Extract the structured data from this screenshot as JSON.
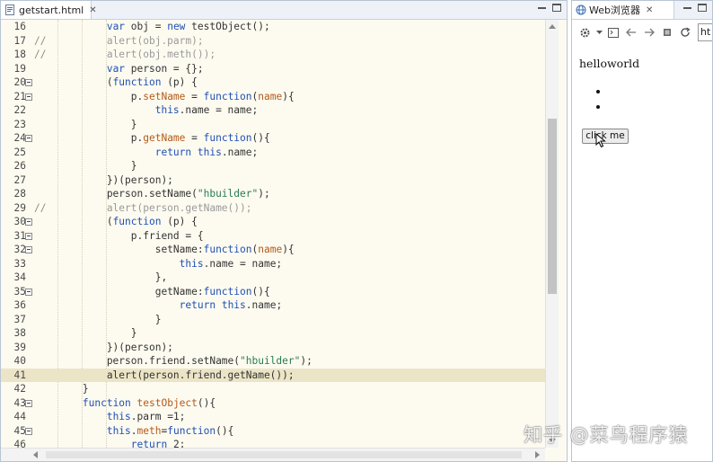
{
  "editor": {
    "tab_label": "getstart.html",
    "tab_close": "✕",
    "lines": [
      {
        "n": "16",
        "fold": false,
        "hl": false,
        "comment": "",
        "html": "            <span>var</span> obj = <span>new</span> testObject();",
        "segs": [
          [
            "            ",
            ""
          ],
          [
            "var",
            "k"
          ],
          [
            " obj = ",
            ""
          ],
          [
            "new",
            "k"
          ],
          [
            " testObject();",
            ""
          ]
        ]
      },
      {
        "n": "17",
        "fold": false,
        "hl": false,
        "comment": "//",
        "segs": [
          [
            "            alert(obj.parm);",
            "c"
          ]
        ]
      },
      {
        "n": "18",
        "fold": false,
        "hl": false,
        "comment": "//",
        "segs": [
          [
            "            alert(obj.meth());",
            "c"
          ]
        ]
      },
      {
        "n": "19",
        "fold": false,
        "hl": false,
        "comment": "",
        "segs": [
          [
            "            ",
            ""
          ],
          [
            "var",
            "k"
          ],
          [
            " person = {};",
            ""
          ]
        ]
      },
      {
        "n": "20",
        "fold": true,
        "hl": false,
        "comment": "",
        "segs": [
          [
            "            (",
            ""
          ],
          [
            "function",
            "k"
          ],
          [
            " (p) {",
            ""
          ]
        ]
      },
      {
        "n": "21",
        "fold": true,
        "hl": false,
        "comment": "",
        "segs": [
          [
            "                p.",
            ""
          ],
          [
            "setName",
            "f"
          ],
          [
            " = ",
            ""
          ],
          [
            "function",
            "k"
          ],
          [
            "(",
            ""
          ],
          [
            "name",
            "f"
          ],
          [
            "){",
            ""
          ]
        ]
      },
      {
        "n": "22",
        "fold": false,
        "hl": false,
        "comment": "",
        "segs": [
          [
            "                    ",
            ""
          ],
          [
            "this",
            "k"
          ],
          [
            ".name = name;",
            ""
          ]
        ]
      },
      {
        "n": "23",
        "fold": false,
        "hl": false,
        "comment": "",
        "segs": [
          [
            "                }",
            ""
          ]
        ]
      },
      {
        "n": "24",
        "fold": true,
        "hl": false,
        "comment": "",
        "segs": [
          [
            "                p.",
            ""
          ],
          [
            "getName",
            "f"
          ],
          [
            " = ",
            ""
          ],
          [
            "function",
            "k"
          ],
          [
            "(){",
            ""
          ]
        ]
      },
      {
        "n": "25",
        "fold": false,
        "hl": false,
        "comment": "",
        "segs": [
          [
            "                    ",
            ""
          ],
          [
            "return",
            "k"
          ],
          [
            " ",
            ""
          ],
          [
            "this",
            "k"
          ],
          [
            ".name;",
            ""
          ]
        ]
      },
      {
        "n": "26",
        "fold": false,
        "hl": false,
        "comment": "",
        "segs": [
          [
            "                }",
            ""
          ]
        ]
      },
      {
        "n": "27",
        "fold": false,
        "hl": false,
        "comment": "",
        "segs": [
          [
            "            })(person);",
            ""
          ]
        ]
      },
      {
        "n": "28",
        "fold": false,
        "hl": false,
        "comment": "",
        "segs": [
          [
            "            person.setName(",
            ""
          ],
          [
            "\"hbuilder\"",
            "s"
          ],
          [
            ");",
            ""
          ]
        ]
      },
      {
        "n": "29",
        "fold": false,
        "hl": false,
        "comment": "//",
        "segs": [
          [
            "            alert(person.getName());",
            "c"
          ]
        ]
      },
      {
        "n": "30",
        "fold": true,
        "hl": false,
        "comment": "",
        "segs": [
          [
            "            (",
            ""
          ],
          [
            "function",
            "k"
          ],
          [
            " (p) {",
            ""
          ]
        ]
      },
      {
        "n": "31",
        "fold": true,
        "hl": false,
        "comment": "",
        "segs": [
          [
            "                p.friend = {",
            ""
          ]
        ]
      },
      {
        "n": "32",
        "fold": true,
        "hl": false,
        "comment": "",
        "segs": [
          [
            "                    setName:",
            ""
          ],
          [
            "function",
            "k"
          ],
          [
            "(",
            ""
          ],
          [
            "name",
            "f"
          ],
          [
            "){",
            ""
          ]
        ]
      },
      {
        "n": "33",
        "fold": false,
        "hl": false,
        "comment": "",
        "segs": [
          [
            "                        ",
            ""
          ],
          [
            "this",
            "k"
          ],
          [
            ".name = name;",
            ""
          ]
        ]
      },
      {
        "n": "34",
        "fold": false,
        "hl": false,
        "comment": "",
        "segs": [
          [
            "                    },",
            ""
          ]
        ]
      },
      {
        "n": "35",
        "fold": true,
        "hl": false,
        "comment": "",
        "segs": [
          [
            "                    getName:",
            ""
          ],
          [
            "function",
            "k"
          ],
          [
            "(){",
            ""
          ]
        ]
      },
      {
        "n": "36",
        "fold": false,
        "hl": false,
        "comment": "",
        "segs": [
          [
            "                        ",
            ""
          ],
          [
            "return",
            "k"
          ],
          [
            " ",
            ""
          ],
          [
            "this",
            "k"
          ],
          [
            ".name;",
            ""
          ]
        ]
      },
      {
        "n": "37",
        "fold": false,
        "hl": false,
        "comment": "",
        "segs": [
          [
            "                    }",
            ""
          ]
        ]
      },
      {
        "n": "38",
        "fold": false,
        "hl": false,
        "comment": "",
        "segs": [
          [
            "                }",
            ""
          ]
        ]
      },
      {
        "n": "39",
        "fold": false,
        "hl": false,
        "comment": "",
        "segs": [
          [
            "            })(person);",
            ""
          ]
        ]
      },
      {
        "n": "40",
        "fold": false,
        "hl": false,
        "comment": "",
        "segs": [
          [
            "            person.friend.setName(",
            ""
          ],
          [
            "\"hbuilder\"",
            "s"
          ],
          [
            ");",
            ""
          ]
        ]
      },
      {
        "n": "41",
        "fold": false,
        "hl": true,
        "comment": "",
        "segs": [
          [
            "            alert(person.friend.getName());",
            ""
          ]
        ]
      },
      {
        "n": "42",
        "fold": false,
        "hl": false,
        "comment": "",
        "segs": [
          [
            "        }",
            ""
          ]
        ]
      },
      {
        "n": "43",
        "fold": true,
        "hl": false,
        "comment": "",
        "segs": [
          [
            "        ",
            ""
          ],
          [
            "function",
            "k"
          ],
          [
            " ",
            ""
          ],
          [
            "testObject",
            "f"
          ],
          [
            "(){",
            ""
          ]
        ]
      },
      {
        "n": "44",
        "fold": false,
        "hl": false,
        "comment": "",
        "segs": [
          [
            "            ",
            ""
          ],
          [
            "this",
            "k"
          ],
          [
            ".parm =1;",
            ""
          ]
        ]
      },
      {
        "n": "45",
        "fold": true,
        "hl": false,
        "comment": "",
        "segs": [
          [
            "            ",
            ""
          ],
          [
            "this",
            "k"
          ],
          [
            ".",
            ""
          ],
          [
            "meth",
            "f"
          ],
          [
            "=",
            ""
          ],
          [
            "function",
            "k"
          ],
          [
            "(){",
            ""
          ]
        ]
      },
      {
        "n": "46",
        "fold": false,
        "hl": false,
        "comment": "",
        "segs": [
          [
            "                ",
            ""
          ],
          [
            "return",
            "k"
          ],
          [
            " 2;",
            ""
          ]
        ]
      }
    ]
  },
  "browser": {
    "tab_label": "Web浏览器",
    "tab_close": "✕",
    "url_partial": "ht",
    "content": {
      "text": "helloworld",
      "button_label": "click me"
    }
  },
  "watermark": "知乎 @菜鸟程序猿"
}
